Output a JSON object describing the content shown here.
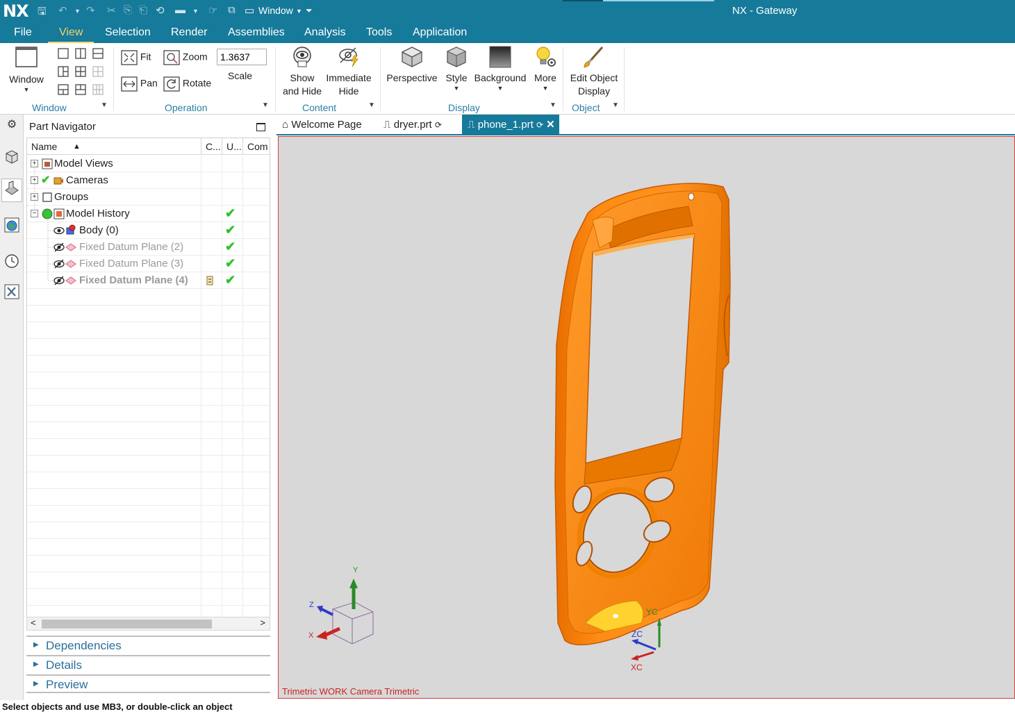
{
  "titlebar": {
    "logo": "NX",
    "window_menu": "Window",
    "title": "NX - Gateway"
  },
  "menubar": {
    "items": [
      "File",
      "View",
      "Selection",
      "Render",
      "Assemblies",
      "Analysis",
      "Tools",
      "Application"
    ],
    "active": "View"
  },
  "ribbon": {
    "window_btn": "Window",
    "fit": "Fit",
    "zoom": "Zoom",
    "pan": "Pan",
    "rotate": "Rotate",
    "scale_value": "1.3637",
    "scale_label": "Scale",
    "show_hide_1": "Show",
    "show_hide_2": "and Hide",
    "immediate_1": "Immediate",
    "immediate_2": "Hide",
    "perspective": "Perspective",
    "style": "Style",
    "background": "Background",
    "more": "More",
    "edit_obj_1": "Edit Object",
    "edit_obj_2": "Display",
    "groups": {
      "window": "Window",
      "operation": "Operation",
      "content": "Content",
      "display": "Display",
      "object": "Object"
    }
  },
  "navigator": {
    "title": "Part Navigator",
    "columns": [
      "Name",
      "C...",
      "U...",
      "Com"
    ],
    "rows": [
      {
        "label": "Model Views",
        "style": "normal",
        "check": ""
      },
      {
        "label": "Cameras",
        "style": "normal",
        "check": ""
      },
      {
        "label": "Groups",
        "style": "normal",
        "check": ""
      },
      {
        "label": "Model History",
        "style": "normal",
        "check": "✔"
      },
      {
        "label": "Body (0)",
        "style": "normal",
        "check": "✔"
      },
      {
        "label": "Fixed Datum Plane (2)",
        "style": "dim",
        "check": "✔"
      },
      {
        "label": "Fixed Datum Plane (3)",
        "style": "dim",
        "check": "✔"
      },
      {
        "label": "Fixed Datum Plane (4)",
        "style": "dimbold",
        "check": "✔"
      }
    ],
    "panels": [
      "Dependencies",
      "Details",
      "Preview"
    ]
  },
  "tabs": [
    {
      "label": "Welcome Page",
      "active": false
    },
    {
      "label": "dryer.prt",
      "active": false
    },
    {
      "label": "phone_1.prt",
      "active": true
    }
  ],
  "viewport": {
    "triad": {
      "x": "X",
      "y": "Y",
      "z": "Z"
    },
    "csys": {
      "xc": "XC",
      "yc": "YC",
      "zc": "ZC"
    },
    "label": "Trimetric WORK Camera Trimetric",
    "model_color": "#ff8c0a"
  },
  "status": "Select objects and use MB3, or double-click an object"
}
